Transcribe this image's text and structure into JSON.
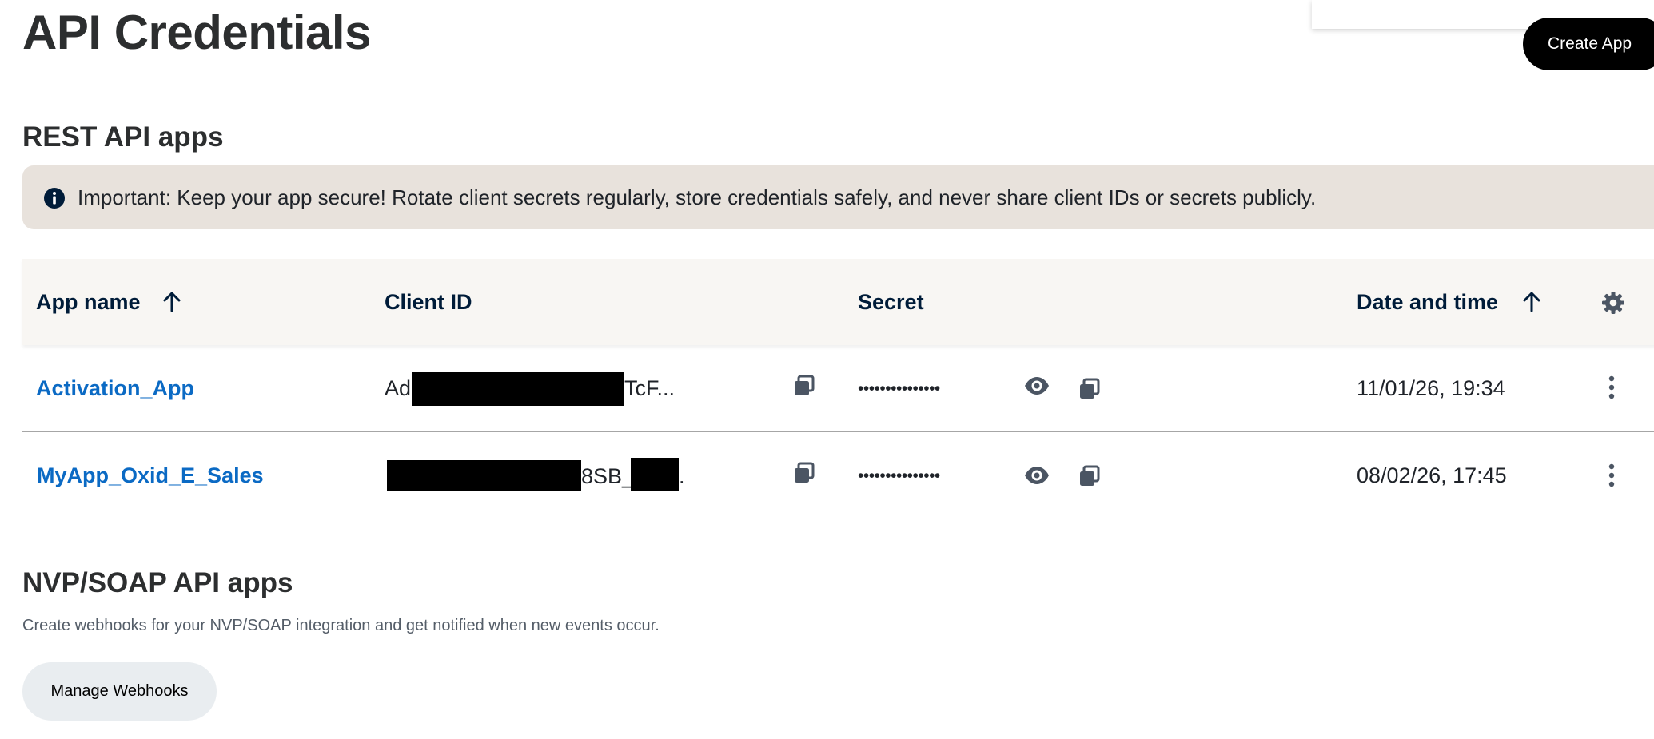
{
  "page": {
    "title": "API Credentials",
    "create_app_label": "Create App"
  },
  "rest": {
    "title": "REST API apps",
    "banner_text": "Important: Keep your app secure! Rotate client secrets regularly, store credentials safely, and never share client IDs or secrets publicly.",
    "columns": {
      "app_name": "App name",
      "client_id": "Client ID",
      "secret": "Secret",
      "date_time": "Date and time"
    },
    "rows": [
      {
        "app_name": "Activation_App",
        "client_id_prefix": "Ad",
        "client_id_suffix": "TcF...",
        "secret_masked": "•••••••••••••••",
        "date_time": "11/01/26, 19:34"
      },
      {
        "app_name": "MyApp_Oxid_E_Sales",
        "client_id_mid": "8SB_",
        "client_id_end": ".",
        "secret_masked": "•••••••••••••••",
        "date_time": "08/02/26, 17:45"
      }
    ]
  },
  "nvp": {
    "title": "NVP/SOAP API apps",
    "description": "Create webhooks for your NVP/SOAP integration and get notified when new events occur.",
    "manage_label": "Manage Webhooks"
  },
  "icons": {
    "info": "info-icon",
    "sort": "arrow-up-icon",
    "settings": "gear-icon",
    "copy": "copy-icon",
    "show": "eye-icon",
    "more": "more-vertical-icon"
  },
  "colors": {
    "link": "#0b6ac4",
    "banner_bg": "#e8e2dc",
    "header_bg": "#f8f6f3",
    "primary_button": "#000000"
  }
}
